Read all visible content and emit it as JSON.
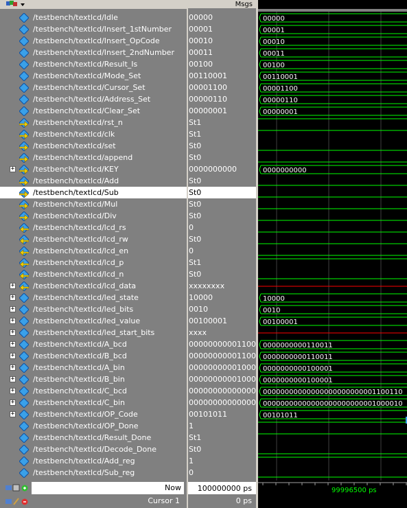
{
  "header": {
    "msgs_label": "Msgs"
  },
  "colors": {
    "selection": "#ffffff",
    "signal_green": "#00ff00",
    "unknown_red": "#ff0000",
    "time_green": "#00ff00"
  },
  "signals": [
    {
      "name": "/testbench/textlcd/Idle",
      "value": "00000",
      "icon": "parameter-icon",
      "expandable": false,
      "wave": "bus",
      "label": "00000"
    },
    {
      "name": "/testbench/textlcd/Insert_1stNumber",
      "value": "00001",
      "icon": "parameter-icon",
      "expandable": false,
      "wave": "bus",
      "label": "00001"
    },
    {
      "name": "/testbench/textlcd/Insert_OpCode",
      "value": "00010",
      "icon": "parameter-icon",
      "expandable": false,
      "wave": "bus",
      "label": "00010"
    },
    {
      "name": "/testbench/textlcd/Insert_2ndNumber",
      "value": "00011",
      "icon": "parameter-icon",
      "expandable": false,
      "wave": "bus",
      "label": "00011"
    },
    {
      "name": "/testbench/textlcd/Result_Is",
      "value": "00100",
      "icon": "parameter-icon",
      "expandable": false,
      "wave": "bus",
      "label": "00100"
    },
    {
      "name": "/testbench/textlcd/Mode_Set",
      "value": "00110001",
      "icon": "parameter-icon",
      "expandable": false,
      "wave": "bus",
      "label": "00110001"
    },
    {
      "name": "/testbench/textlcd/Cursor_Set",
      "value": "00001100",
      "icon": "parameter-icon",
      "expandable": false,
      "wave": "bus",
      "label": "00001100"
    },
    {
      "name": "/testbench/textlcd/Address_Set",
      "value": "00000110",
      "icon": "parameter-icon",
      "expandable": false,
      "wave": "bus",
      "label": "00000110"
    },
    {
      "name": "/testbench/textlcd/Clear_Set",
      "value": "00000001",
      "icon": "parameter-icon",
      "expandable": false,
      "wave": "bus",
      "label": "00000001"
    },
    {
      "name": "/testbench/textlcd/rst_n",
      "value": "St1",
      "icon": "input-icon",
      "expandable": false,
      "wave": "high",
      "label": ""
    },
    {
      "name": "/testbench/textlcd/clk",
      "value": "St1",
      "icon": "input-icon",
      "expandable": false,
      "wave": "high",
      "label": ""
    },
    {
      "name": "/testbench/textlcd/set",
      "value": "St0",
      "icon": "input-icon",
      "expandable": false,
      "wave": "low",
      "label": ""
    },
    {
      "name": "/testbench/textlcd/append",
      "value": "St0",
      "icon": "input-icon",
      "expandable": false,
      "wave": "low",
      "label": ""
    },
    {
      "name": "/testbench/textlcd/KEY",
      "value": "0000000000",
      "icon": "input-icon",
      "expandable": true,
      "wave": "bus",
      "label": "0000000000"
    },
    {
      "name": "/testbench/textlcd/Add",
      "value": "St0",
      "icon": "input-icon",
      "expandable": false,
      "wave": "low",
      "label": ""
    },
    {
      "name": "/testbench/textlcd/Sub",
      "value": "St0",
      "icon": "input-icon",
      "expandable": false,
      "wave": "low",
      "label": "",
      "selected": true
    },
    {
      "name": "/testbench/textlcd/Mul",
      "value": "St0",
      "icon": "input-icon",
      "expandable": false,
      "wave": "low",
      "label": ""
    },
    {
      "name": "/testbench/textlcd/Div",
      "value": "St0",
      "icon": "input-icon",
      "expandable": false,
      "wave": "low",
      "label": ""
    },
    {
      "name": "/testbench/textlcd/lcd_rs",
      "value": "0",
      "icon": "output-icon",
      "expandable": false,
      "wave": "low",
      "label": ""
    },
    {
      "name": "/testbench/textlcd/lcd_rw",
      "value": "St0",
      "icon": "output-icon",
      "expandable": false,
      "wave": "low",
      "label": ""
    },
    {
      "name": "/testbench/textlcd/lcd_en",
      "value": "0",
      "icon": "output-icon",
      "expandable": false,
      "wave": "low",
      "label": ""
    },
    {
      "name": "/testbench/textlcd/lcd_p",
      "value": "St1",
      "icon": "output-icon",
      "expandable": false,
      "wave": "high",
      "label": ""
    },
    {
      "name": "/testbench/textlcd/lcd_n",
      "value": "St0",
      "icon": "output-icon",
      "expandable": false,
      "wave": "low",
      "label": ""
    },
    {
      "name": "/testbench/textlcd/lcd_data",
      "value": "xxxxxxxx",
      "icon": "output-icon",
      "expandable": true,
      "wave": "x",
      "label": ""
    },
    {
      "name": "/testbench/textlcd/led_state",
      "value": "10000",
      "icon": "parameter-icon",
      "expandable": true,
      "wave": "bus",
      "label": "10000"
    },
    {
      "name": "/testbench/textlcd/led_bits",
      "value": "0010",
      "icon": "parameter-icon",
      "expandable": true,
      "wave": "bus",
      "label": "0010"
    },
    {
      "name": "/testbench/textlcd/led_value",
      "value": "00100001",
      "icon": "parameter-icon",
      "expandable": true,
      "wave": "bus",
      "label": "00100001"
    },
    {
      "name": "/testbench/textlcd/led_start_bits",
      "value": "xxxx",
      "icon": "parameter-icon",
      "expandable": true,
      "wave": "x",
      "label": ""
    },
    {
      "name": "/testbench/textlcd/A_bcd",
      "value": "0000000000110011",
      "icon": "parameter-icon",
      "expandable": true,
      "wave": "bus",
      "label": "0000000000110011"
    },
    {
      "name": "/testbench/textlcd/B_bcd",
      "value": "0000000000110011",
      "icon": "parameter-icon",
      "expandable": true,
      "wave": "bus",
      "label": "0000000000110011"
    },
    {
      "name": "/testbench/textlcd/A_bin",
      "value": "0000000000100001",
      "icon": "parameter-icon",
      "expandable": true,
      "wave": "bus",
      "label": "0000000000100001"
    },
    {
      "name": "/testbench/textlcd/B_bin",
      "value": "0000000000100001",
      "icon": "parameter-icon",
      "expandable": true,
      "wave": "bus",
      "label": "0000000000100001"
    },
    {
      "name": "/testbench/textlcd/C_bcd",
      "value": "00000000000000...",
      "icon": "parameter-icon",
      "expandable": true,
      "wave": "bus",
      "label": "00000000000000000000000001100110"
    },
    {
      "name": "/testbench/textlcd/C_bin",
      "value": "00000000000000...",
      "icon": "parameter-icon",
      "expandable": true,
      "wave": "bus",
      "label": "00000000000000000000000001000010"
    },
    {
      "name": "/testbench/textlcd/OP_Code",
      "value": "00101011",
      "icon": "parameter-icon",
      "expandable": true,
      "wave": "bus",
      "label": "00101011"
    },
    {
      "name": "/testbench/textlcd/OP_Done",
      "value": "1",
      "icon": "parameter-icon",
      "expandable": false,
      "wave": "high",
      "label": ""
    },
    {
      "name": "/testbench/textlcd/Result_Done",
      "value": "St1",
      "icon": "parameter-icon",
      "expandable": false,
      "wave": "high",
      "label": ""
    },
    {
      "name": "/testbench/textlcd/Decode_Done",
      "value": "St0",
      "icon": "parameter-icon",
      "expandable": false,
      "wave": "low",
      "label": ""
    },
    {
      "name": "/testbench/textlcd/Add_reg",
      "value": "1",
      "icon": "parameter-icon",
      "expandable": false,
      "wave": "high",
      "label": ""
    },
    {
      "name": "/testbench/textlcd/Sub_reg",
      "value": "0",
      "icon": "parameter-icon",
      "expandable": false,
      "wave": "low",
      "label": ""
    }
  ],
  "footer": {
    "now_label": "Now",
    "now_value": "100000000 ps",
    "cursor_label": "Cursor 1",
    "cursor_value": "0 ps",
    "cursor_time": "99996500 ps"
  }
}
